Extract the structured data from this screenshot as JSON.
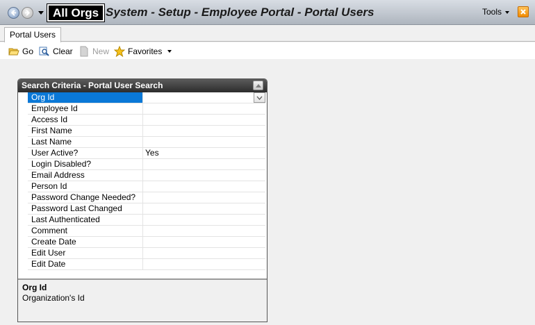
{
  "titlebar": {
    "org_badge": "All Orgs",
    "title": "System - Setup - Employee Portal - Portal Users",
    "tools_label": "Tools",
    "icons": {
      "back": "back-arrow-icon",
      "forward": "forward-arrow-icon",
      "close": "close-icon"
    }
  },
  "tabs": [
    {
      "label": "Portal Users"
    }
  ],
  "toolbar": {
    "go_label": "Go",
    "clear_label": "Clear",
    "new_label": "New",
    "favorites_label": "Favorites"
  },
  "panel": {
    "title": "Search Criteria - Portal User Search",
    "rows": [
      {
        "label": "Org Id",
        "value": ""
      },
      {
        "label": "Employee Id",
        "value": ""
      },
      {
        "label": "Access Id",
        "value": ""
      },
      {
        "label": "First Name",
        "value": ""
      },
      {
        "label": "Last Name",
        "value": ""
      },
      {
        "label": "User Active?",
        "value": "Yes"
      },
      {
        "label": "Login Disabled?",
        "value": ""
      },
      {
        "label": "Email Address",
        "value": ""
      },
      {
        "label": "Person Id",
        "value": ""
      },
      {
        "label": "Password Change Needed?",
        "value": ""
      },
      {
        "label": "Password Last Changed",
        "value": ""
      },
      {
        "label": "Last Authenticated",
        "value": ""
      },
      {
        "label": "Comment",
        "value": ""
      },
      {
        "label": "Create Date",
        "value": ""
      },
      {
        "label": "Edit User",
        "value": ""
      },
      {
        "label": "Edit Date",
        "value": ""
      }
    ],
    "selected_index": 0,
    "description": {
      "title": "Org Id",
      "text": "Organization's Id"
    }
  },
  "colors": {
    "selection": "#0a78d7",
    "header_dark": "#2c2c2c",
    "close_orange": "#f28b00"
  }
}
